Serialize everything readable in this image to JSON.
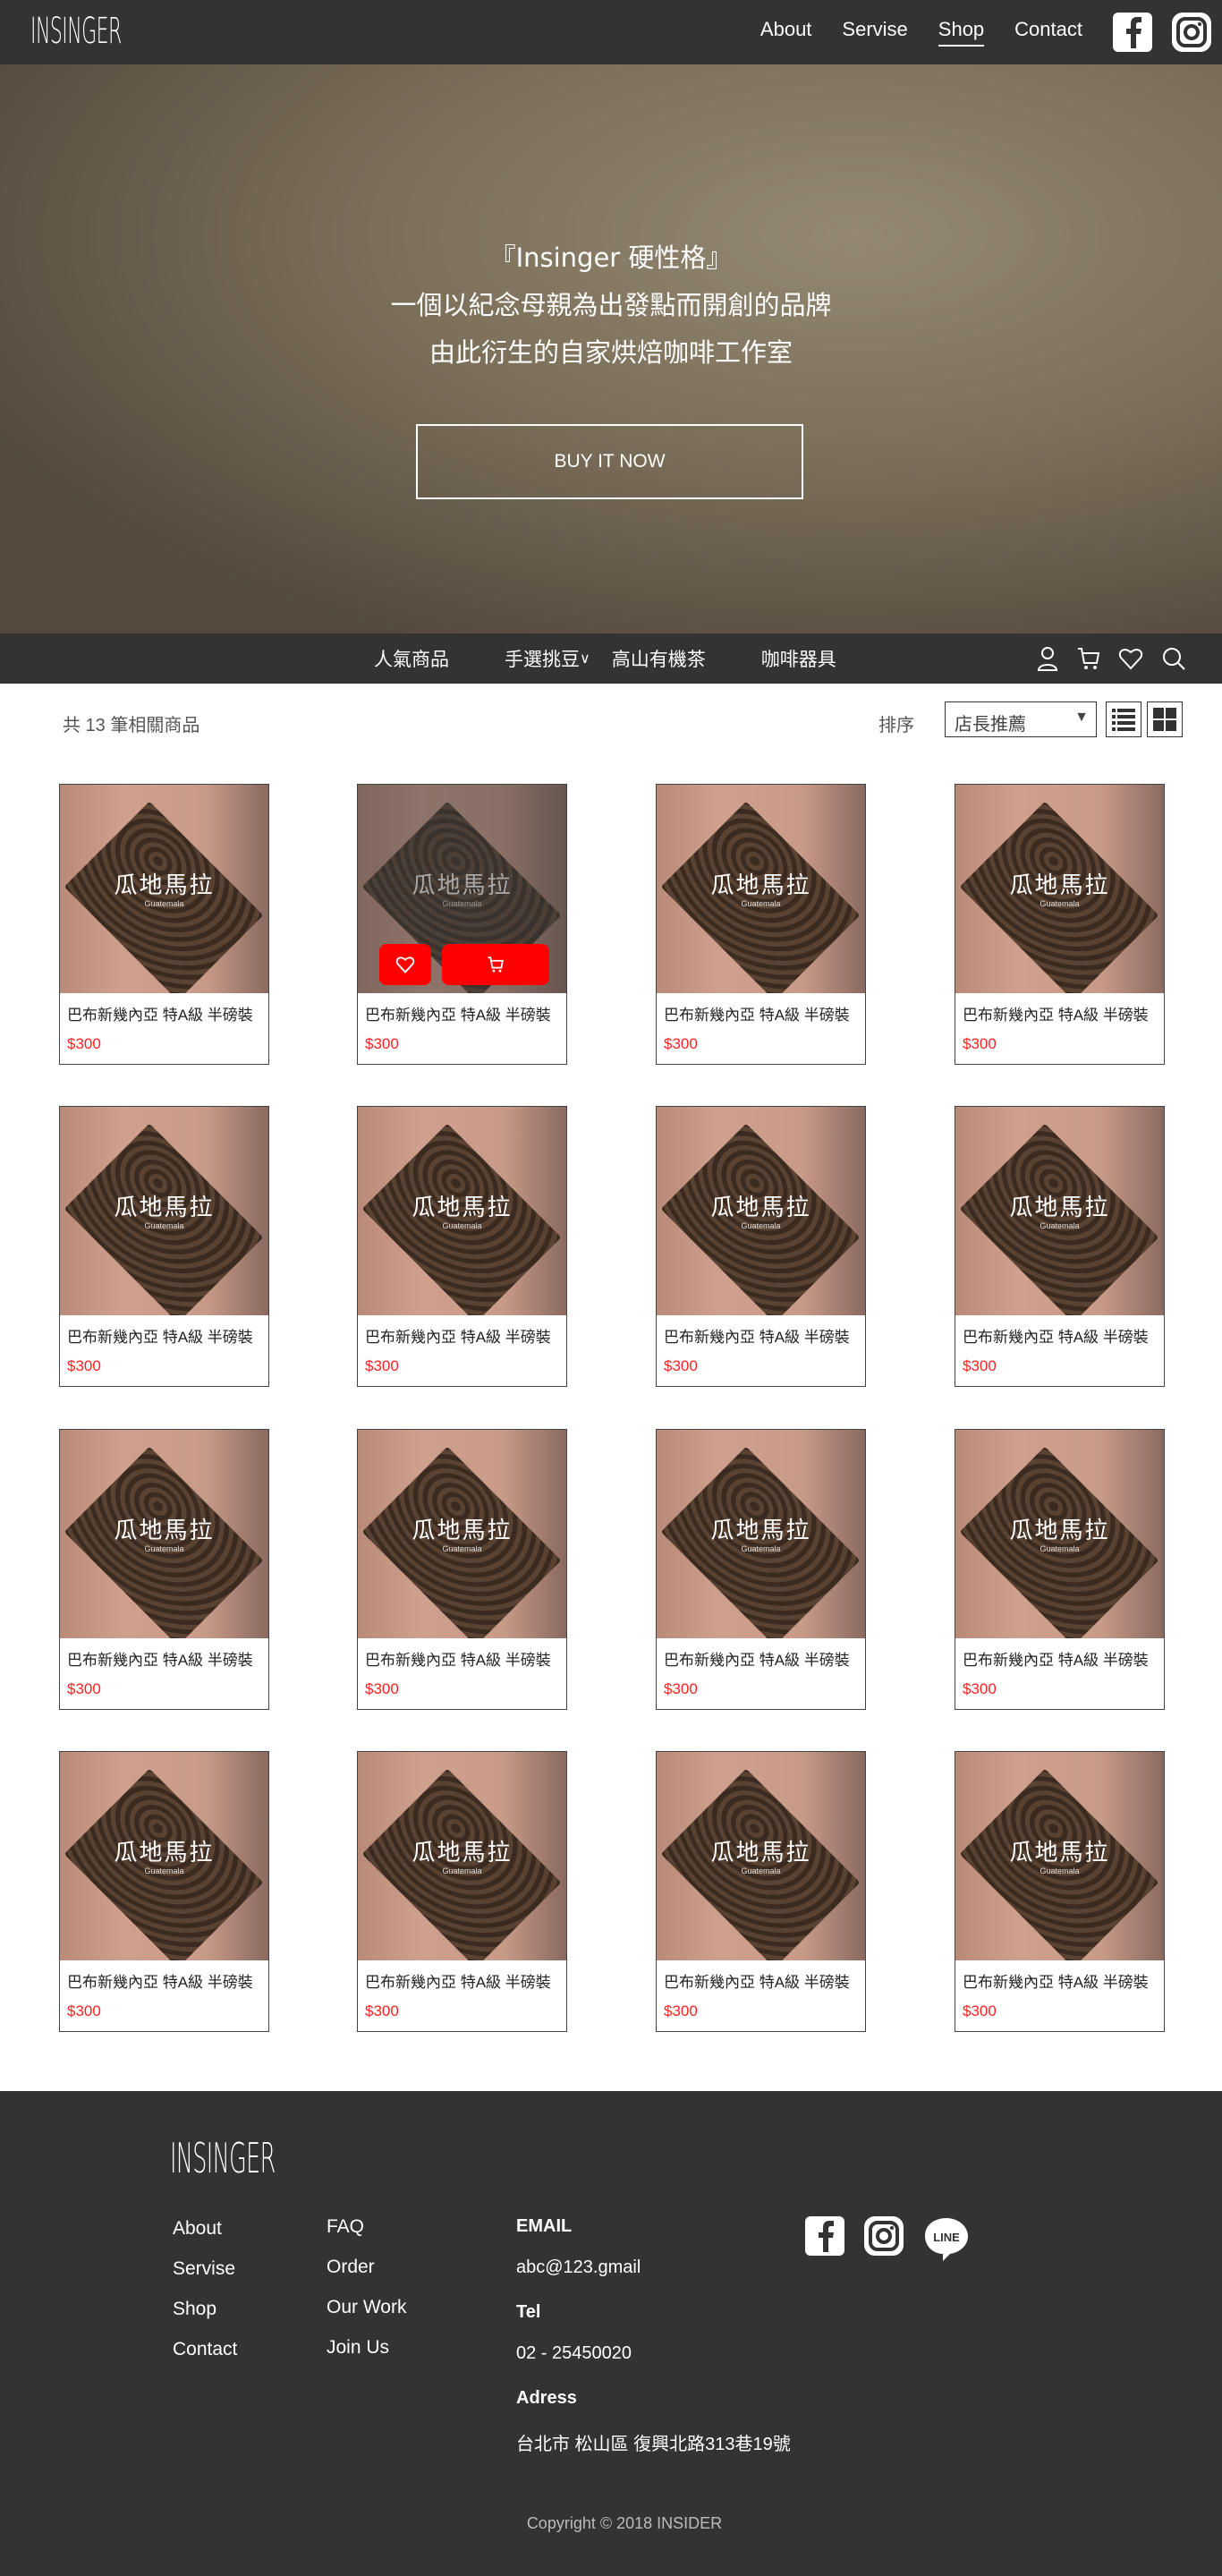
{
  "header": {
    "logo": "INSINGER",
    "nav": [
      {
        "label": "About"
      },
      {
        "label": "Servise"
      },
      {
        "label": "Shop",
        "active": true
      },
      {
        "label": "Contact"
      }
    ],
    "social": [
      "facebook-icon",
      "instagram-icon"
    ]
  },
  "hero": {
    "lines": [
      "『Insinger 硬性格』",
      "一個以紀念母親為出發點而開創的品牌",
      "由此衍生的自家烘焙咖啡工作室"
    ],
    "button": "BUY IT NOW"
  },
  "subnav": {
    "items": [
      "人氣商品",
      "手選挑豆",
      "高山有機茶",
      "咖啡器具"
    ],
    "icons": [
      "user-icon",
      "cart-icon",
      "heart-icon",
      "search-icon"
    ]
  },
  "toolbar": {
    "count": "共 13 筆相關商品",
    "sort_label": "排序",
    "sort_value": "店長推薦"
  },
  "product": {
    "image_title": "瓜地馬拉",
    "image_subtitle": "Guatemala",
    "name": "巴布新幾內亞 特A級 半磅裝",
    "price": "$300"
  },
  "products_count": 16,
  "hovered_index": 1,
  "colors": {
    "dark": "#333333",
    "accent": "#ff0000"
  },
  "footer": {
    "logo": "INSINGER",
    "col1": [
      "About",
      "Servise",
      "Shop",
      "Contact"
    ],
    "col2": [
      "FAQ",
      "Order",
      "Our Work",
      "Join Us"
    ],
    "email_label": "EMAIL",
    "email": "abc@123.gmail",
    "tel_label": "Tel",
    "tel": "02 - 25450020",
    "address_label": "Adress",
    "address": "台北市 松山區 復興北路313巷19號",
    "copyright": "Copyright © 2018 INSIDER",
    "social": [
      "facebook-icon",
      "instagram-icon",
      "line-icon"
    ]
  }
}
